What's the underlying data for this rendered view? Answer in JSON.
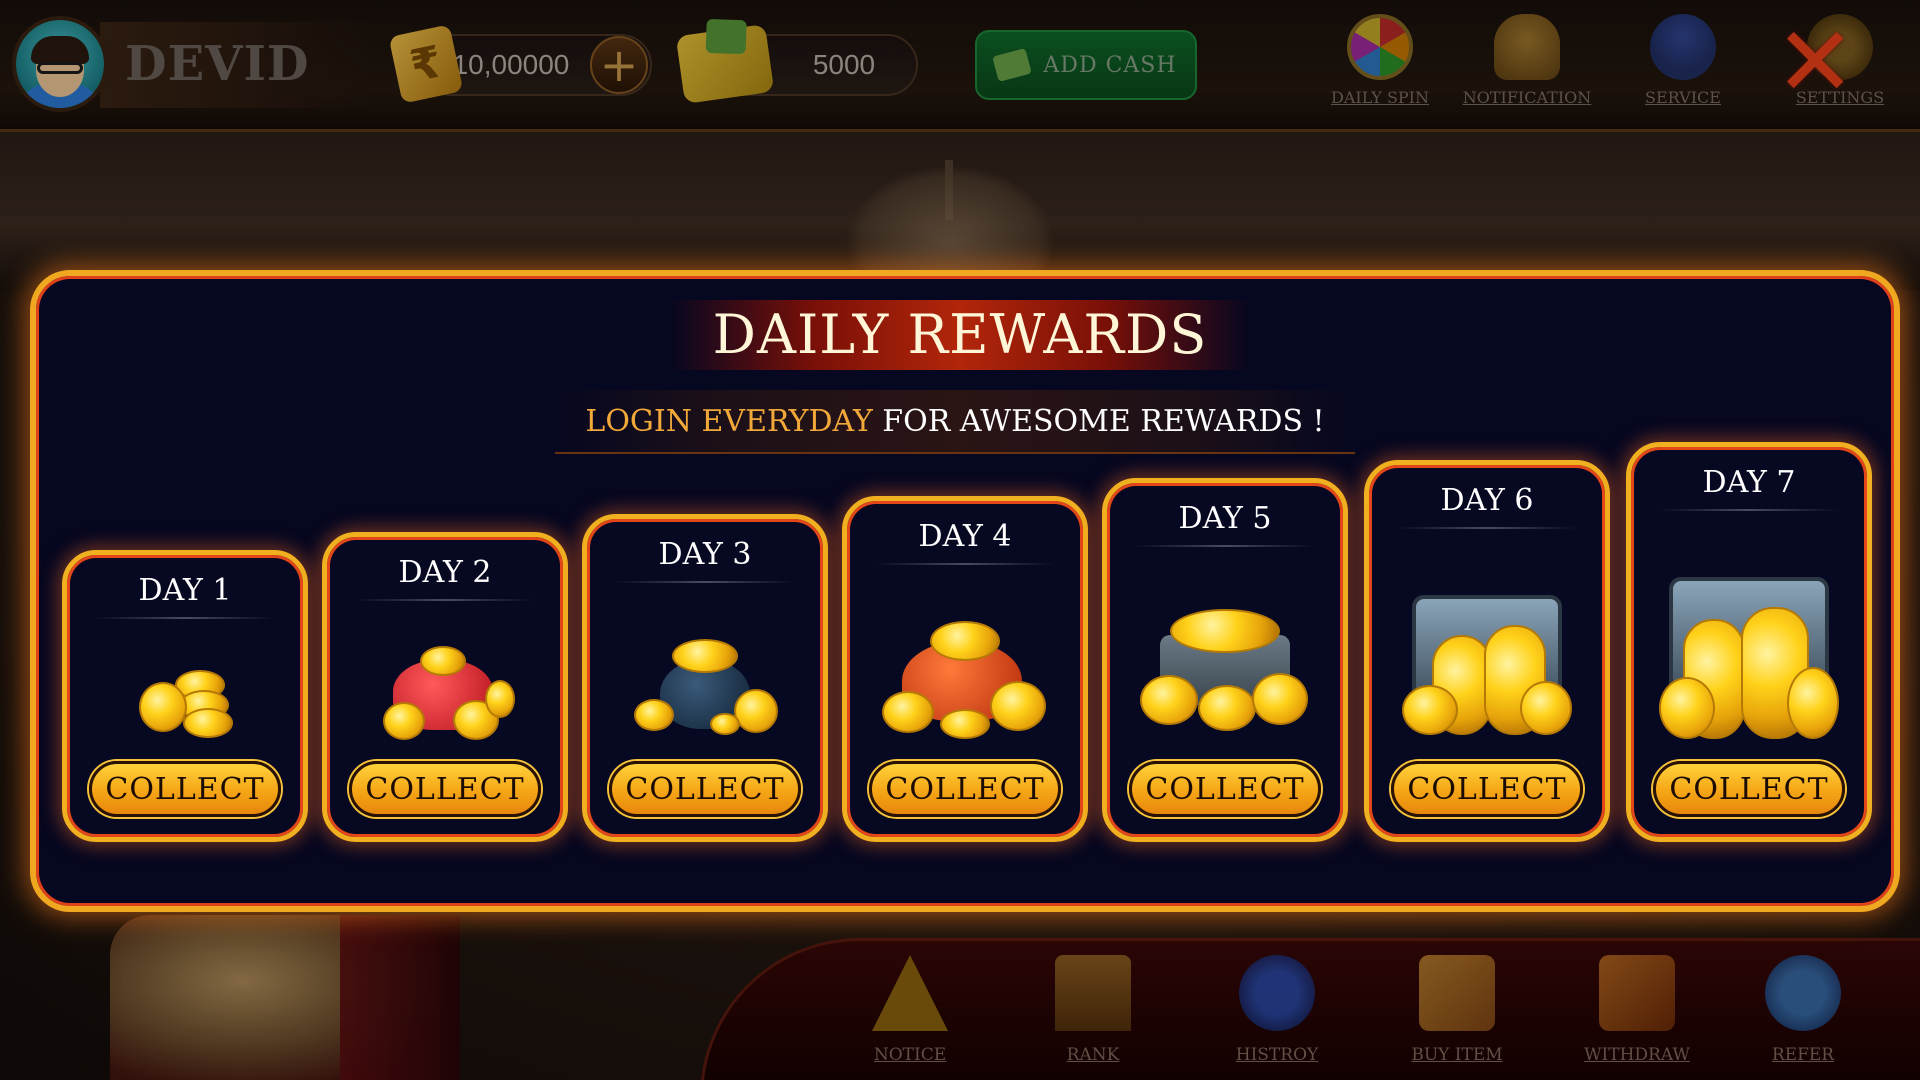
{
  "player": {
    "name": "DEVID"
  },
  "wallet": {
    "coins": "10,00000",
    "bonus": "5000",
    "add_cash_label": "ADD CASH"
  },
  "top_menu": [
    {
      "key": "daily_spin",
      "label": "DAILY SPIN",
      "icon": "spin-wheel-icon"
    },
    {
      "key": "notification",
      "label": "NOTIFICATION",
      "icon": "bell-icon"
    },
    {
      "key": "service",
      "label": "SERVICE",
      "icon": "headset-icon"
    },
    {
      "key": "settings",
      "label": "SETTINGS",
      "icon": "gear-icon"
    }
  ],
  "close_symbol": "✕",
  "modal": {
    "title": "DAILY REWARDS",
    "subtitle_highlight": "LOGIN EVERYDAY",
    "subtitle_rest": " FOR AWESOME REWARDS !",
    "cards": [
      {
        "day": "DAY 1",
        "button": "COLLECT",
        "reward_icon": "small-coin-stack-icon"
      },
      {
        "day": "DAY 2",
        "button": "COLLECT",
        "reward_icon": "coin-purse-icon"
      },
      {
        "day": "DAY 3",
        "button": "COLLECT",
        "reward_icon": "coin-pot-icon"
      },
      {
        "day": "DAY 4",
        "button": "COLLECT",
        "reward_icon": "coin-sack-icon"
      },
      {
        "day": "DAY 5",
        "button": "COLLECT",
        "reward_icon": "coin-chest-icon"
      },
      {
        "day": "DAY 6",
        "button": "COLLECT",
        "reward_icon": "coin-vault-icon"
      },
      {
        "day": "DAY 7",
        "button": "COLLECT",
        "reward_icon": "large-coin-vault-icon"
      }
    ]
  },
  "bottom_menu": [
    {
      "key": "notice",
      "label": "NOTICE",
      "icon": "warning-icon"
    },
    {
      "key": "rank",
      "label": "RANK",
      "icon": "trophy-podium-icon"
    },
    {
      "key": "history",
      "label": "HISTROY",
      "icon": "clock-history-icon"
    },
    {
      "key": "buy_item",
      "label": "BUY ITEM",
      "icon": "gift-box-icon"
    },
    {
      "key": "withdraw",
      "label": "WITHDRAW",
      "icon": "wallet-cards-icon"
    },
    {
      "key": "refer",
      "label": "REFER",
      "icon": "share-icon"
    }
  ],
  "colors": {
    "modal_border": "#f0a820",
    "modal_inner_border": "#e0401a",
    "collect_button": "#f5a516",
    "subtitle_highlight": "#f2a93a",
    "close_x": "#f0401a"
  }
}
